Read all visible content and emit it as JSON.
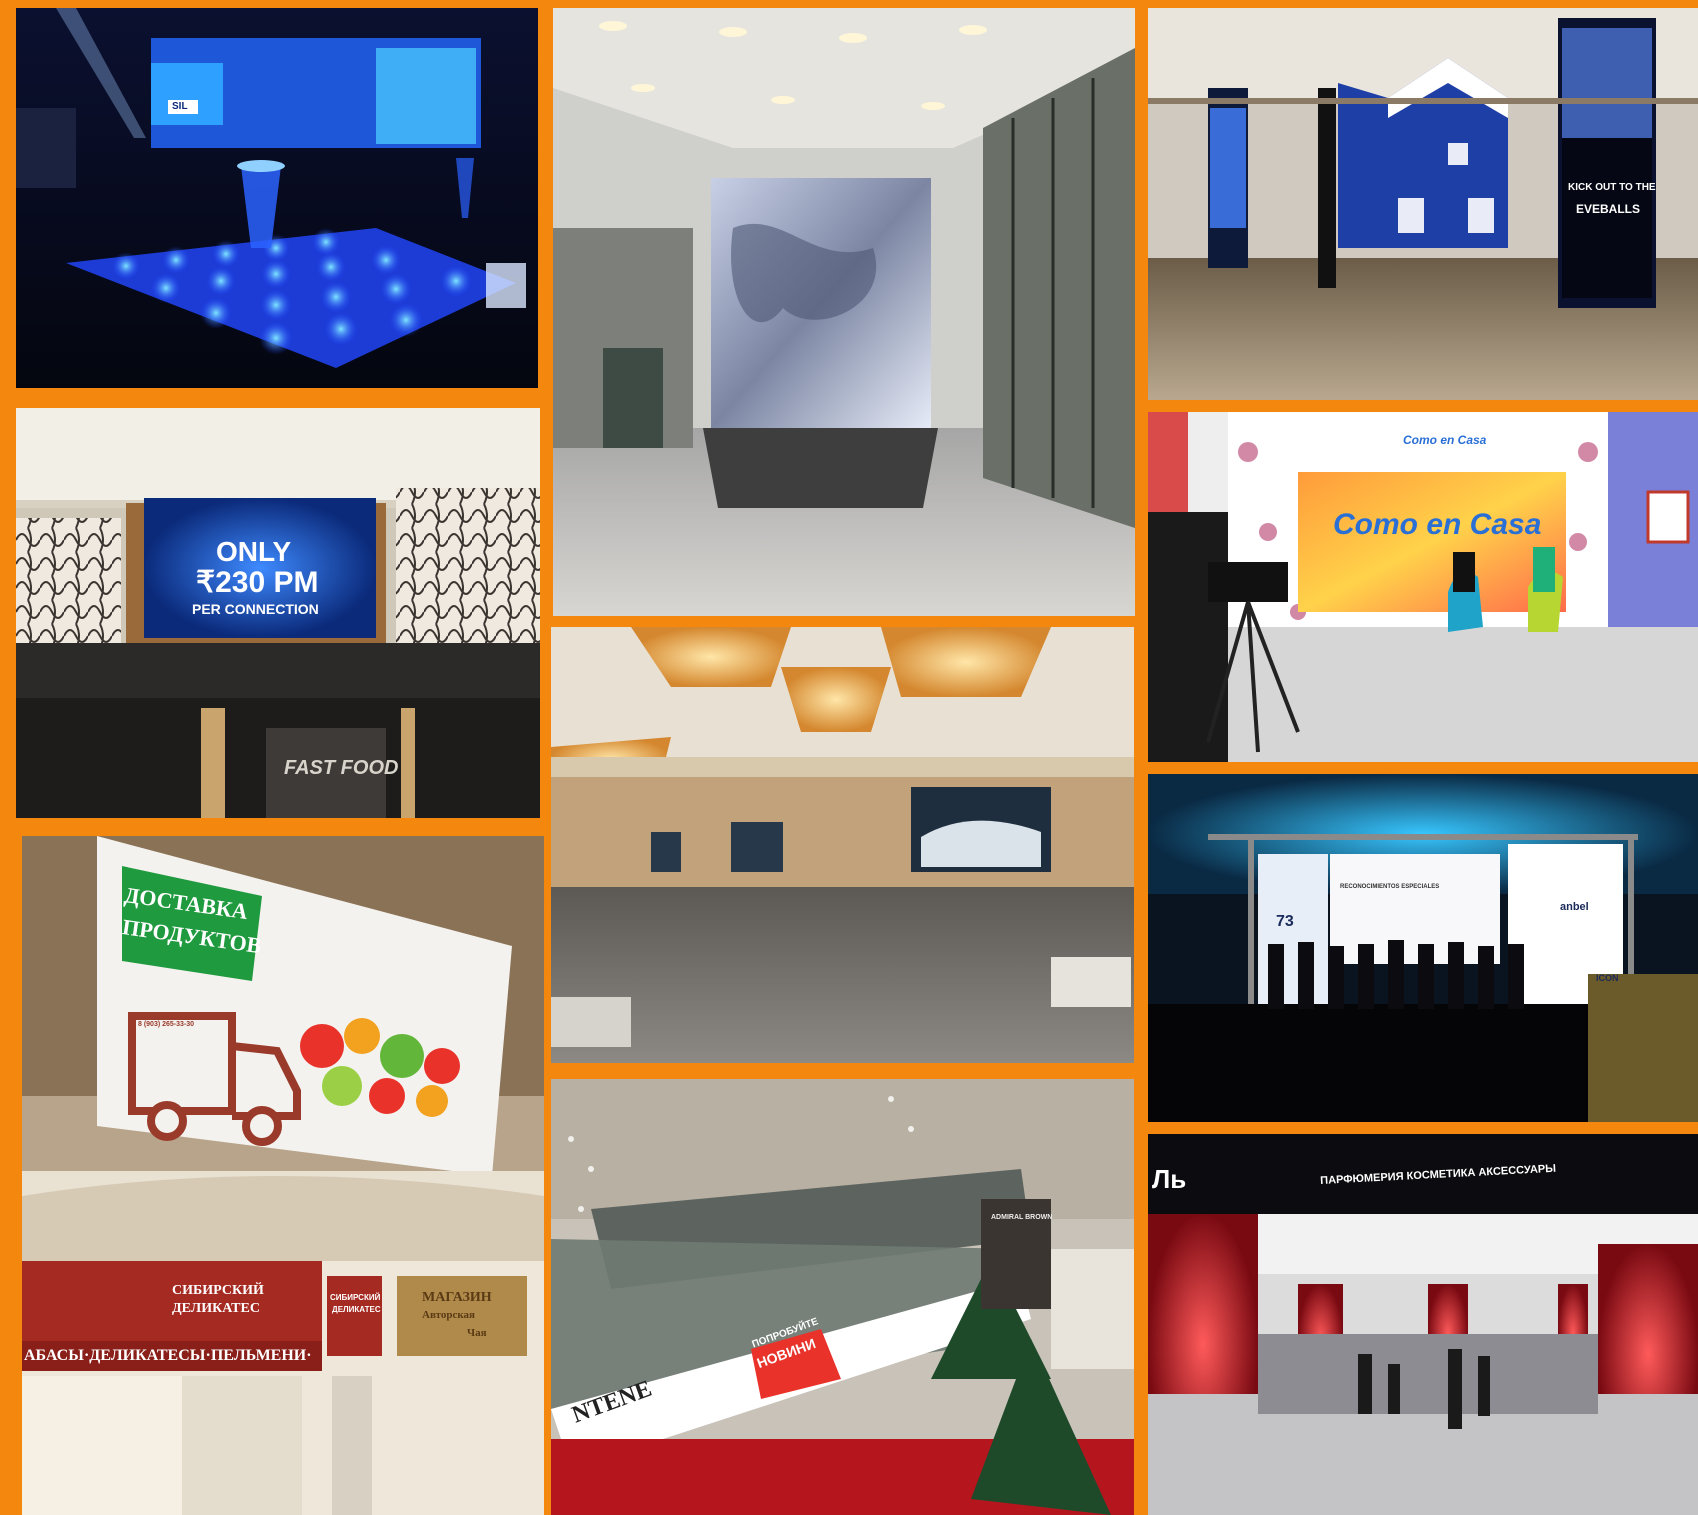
{
  "collage": {
    "background": "#F4870E",
    "panels": [
      {
        "id": "p1",
        "subject": "stage-with-led-floor",
        "texts": {
          "sign": "SIL"
        }
      },
      {
        "id": "p2",
        "subject": "lobby-led-column",
        "texts": {}
      },
      {
        "id": "p3",
        "subject": "mall-led-pillars",
        "texts": {
          "pillar1": "KICK OUT TO THE",
          "pillar2": "EVEBALLS"
        }
      },
      {
        "id": "p4",
        "subject": "wall-screen-mall",
        "texts": {
          "line1": "ONLY",
          "line2": "₹230 PM",
          "line3": "PER CONNECTION",
          "store": "FAST FOOD"
        }
      },
      {
        "id": "p5",
        "subject": "tv-studio-interview",
        "texts": {
          "brand": "Como en Casa",
          "logo_small": "Como en Casa"
        }
      },
      {
        "id": "p6",
        "subject": "ballroom-screens",
        "texts": {}
      },
      {
        "id": "p7",
        "subject": "event-stage-screen",
        "texts": {
          "number": "73",
          "center": "RECONOCIMIENTOS ESPECIALES",
          "right1": "anbel",
          "right2": "ICON"
        }
      },
      {
        "id": "p8",
        "subject": "delivery-billboard",
        "texts": {
          "title1": "ДОСТАВКА",
          "title2": "ПРОДУКТОВ",
          "phone": "8 (903) 265-33-30",
          "store1": "СИБИРСКИЙ",
          "store1b": "ДЕЛИКАТЕС",
          "store2": "СИБИРСКИЙ",
          "store2b": "ДЕЛИКАТЕС",
          "banner": "АБАСЫ·ДЕЛИКАТЕСЫ·ПЕЛЬМЕНИ·",
          "shop": "МАГАЗИН",
          "shop2": "Авторская",
          "shop3": "Чая"
        }
      },
      {
        "id": "p9",
        "subject": "mall-atrium-led-banner",
        "texts": {
          "banner": "NTENE",
          "promo1": "ПОПРОБУЙТЕ",
          "promo2": "НОВИНИ",
          "store": "ADMIRAL BROWN"
        }
      },
      {
        "id": "p10",
        "subject": "cosmetics-store-led",
        "texts": {
          "header": "ПАРФЮМЕРИЯ  КОСМЕТИКА  АКСЕССУАРЫ",
          "logo": "Ль"
        }
      }
    ]
  }
}
